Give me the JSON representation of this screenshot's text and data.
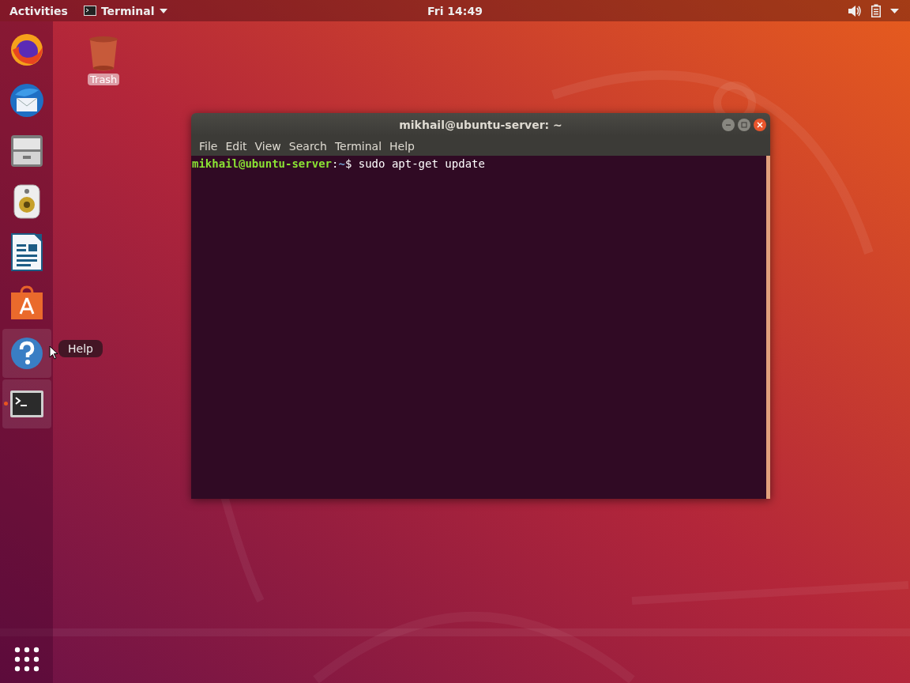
{
  "top_bar": {
    "activities": "Activities",
    "app_menu": {
      "label": "Terminal"
    },
    "clock": "Fri 14:49"
  },
  "dock": {
    "items": [
      {
        "kind": "firefox",
        "hovered": false,
        "running": false
      },
      {
        "kind": "thunderbird",
        "hovered": false,
        "running": false
      },
      {
        "kind": "files",
        "hovered": false,
        "running": false
      },
      {
        "kind": "rhythmbox",
        "hovered": false,
        "running": false
      },
      {
        "kind": "writer",
        "hovered": false,
        "running": false
      },
      {
        "kind": "software",
        "hovered": false,
        "running": false
      },
      {
        "kind": "help",
        "hovered": true,
        "running": false
      },
      {
        "kind": "terminal",
        "hovered": false,
        "running": true
      }
    ],
    "tooltip": "Help"
  },
  "desktop_icons": [
    {
      "label": "Trash"
    }
  ],
  "window": {
    "title": "mikhail@ubuntu-server: ~",
    "menu": [
      "File",
      "Edit",
      "View",
      "Search",
      "Terminal",
      "Help"
    ],
    "lines": [
      {
        "user_host": "mikhail@ubuntu-server",
        "separator": ":",
        "path": "~",
        "symbol": "$",
        "command": "sudo apt-get update"
      }
    ]
  }
}
